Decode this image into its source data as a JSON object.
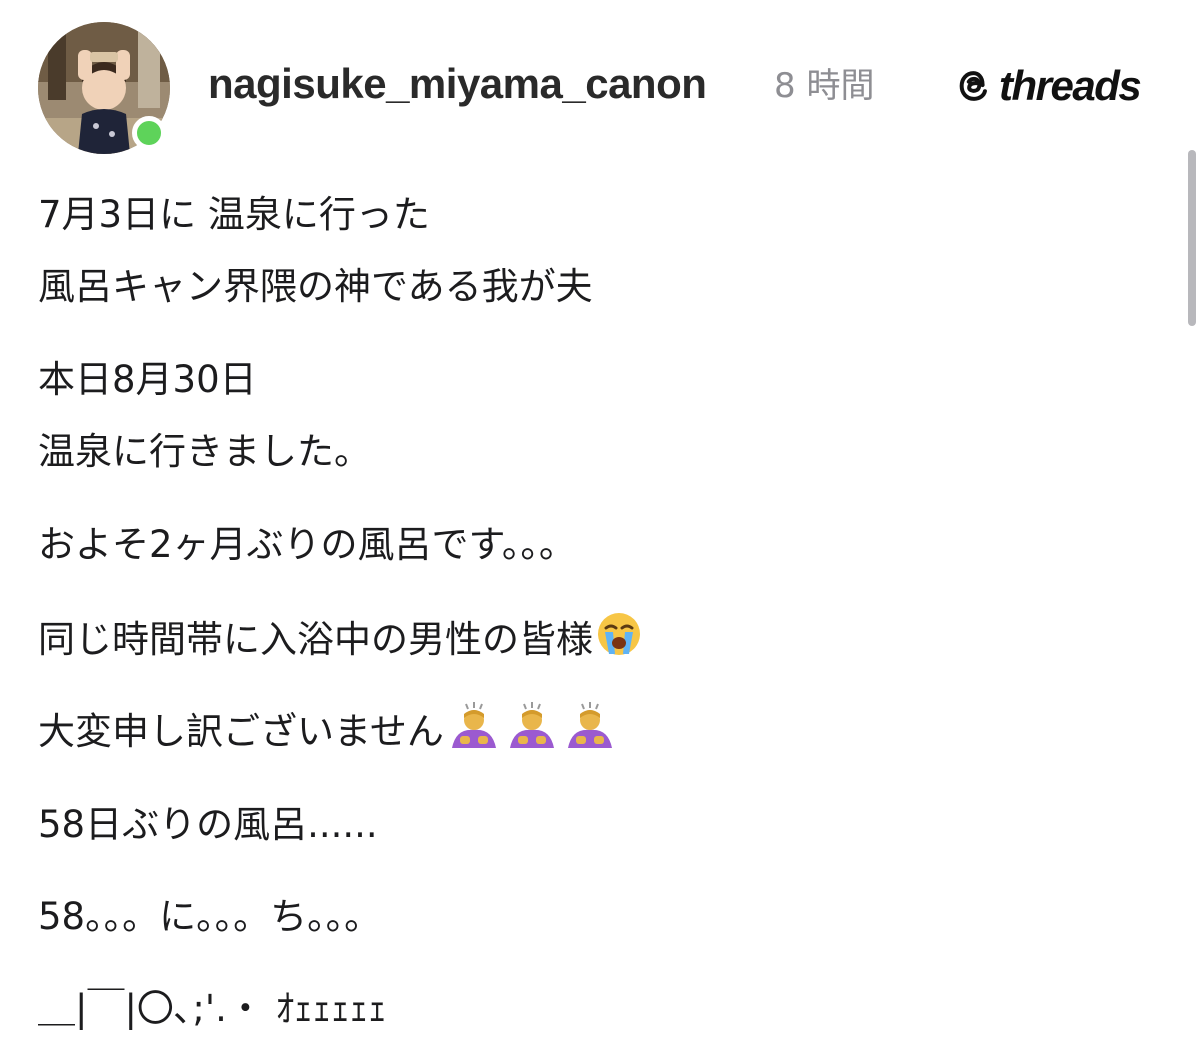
{
  "post": {
    "username": "nagisuke_miyama_canon",
    "timestamp": "8 時間",
    "brand": "threads",
    "online": true,
    "lines": [
      "7月3日に 温泉に行った",
      "風呂キャン界隈の神である我が夫",
      "本日8月30日",
      "温泉に行きました。",
      "およそ2ヶ月ぶりの風呂です。。。",
      "同じ時間帯に入浴中の男性の皆様",
      "大変申し訳ございません",
      "58日ぶりの風呂......",
      "58。。。に。。。ち。。。",
      "＿|￣|〇､;'.・ ｵｪｪｪｪｪ"
    ],
    "emojis": {
      "line6": [
        "loudly-crying-face-emoji"
      ],
      "line7": [
        "bowing-woman-emoji",
        "bowing-woman-emoji",
        "bowing-woman-emoji"
      ]
    }
  },
  "colors": {
    "online_dot": "#5ed35a",
    "username": "#2a2a2a",
    "timestamp": "#8e8e93"
  }
}
